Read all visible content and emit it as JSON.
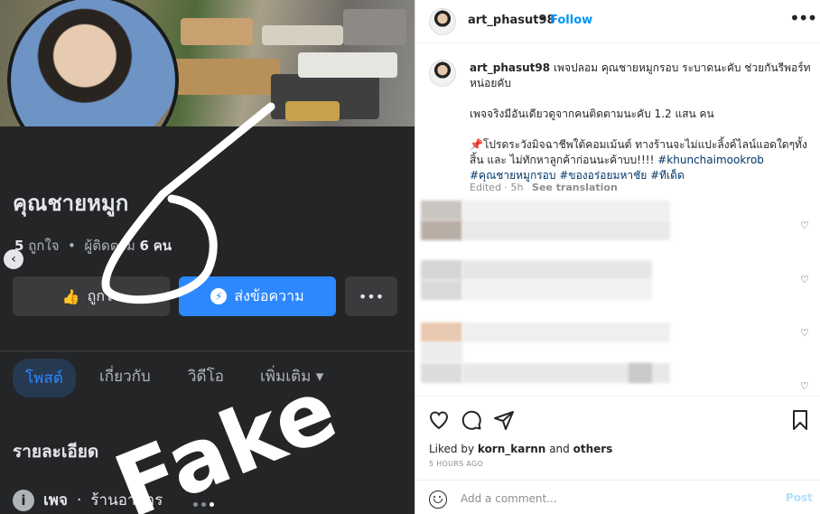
{
  "fb_screenshot": {
    "page_name": "คุณชายหมูก",
    "likes_count": "5",
    "likes_label": "ถูกใจ",
    "followers_label": "ผู้ติดตาม",
    "followers_count": "6",
    "followers_unit": "คน",
    "like_button_label": "ถูกใจ",
    "message_button_label": "ส่งข้อความ",
    "more_button_label": "•••",
    "tabs": [
      "โพสต์",
      "เกี่ยวกับ",
      "วิดีโอ",
      "เพิ่มเติม"
    ],
    "section_title": "รายละเอียด",
    "info_icon": "i",
    "info_type_label": "เพจ",
    "info_category": "ร้านอาหาร",
    "overlay_text": "Fake",
    "colors": {
      "bg": "#242526",
      "accent": "#2d88ff"
    }
  },
  "instagram": {
    "username": "art_phasut98",
    "header_separator": "•",
    "follow_label": "Follow",
    "more_icon": "more-horizontal-icon",
    "caption_username": "art_phasut98",
    "caption_line1": "เพจปลอม คุณชายหมูกรอบ ระบาดนะคับ ช่วยกันรีพอร์ทหน่อยคับ",
    "caption_line2": "เพจจริงมีอันเดียวดูจากคนติดตามนะคับ 1.2 แสน คน",
    "caption_line3": "📌โปรดระวังมิจฉาชีพใต้คอมเม้นต์ ทางร้านจะไม่แปะลิ้งค์ไลน์แอดใดๆทั้งสิ้น และ ไม่ทักหาลูกค้าก่อนนะค้าบบ!!!!",
    "hashtags": [
      "#khunchaimookrob",
      "#คุณชายหมูกรอบ",
      "#ของอร่อยมหาชัย",
      "#ทีเด็ด"
    ],
    "edited_time": "Edited · 5h",
    "see_translation": "See translation",
    "liked_prefix": "Liked by",
    "liked_user": "korn_karnn",
    "liked_suffix": "and",
    "liked_others": "others",
    "posted_ago": "5 HOURS AGO",
    "comment_placeholder": "Add a comment...",
    "post_label": "Post",
    "colors": {
      "link": "#0095f6",
      "hashtag": "#00376b",
      "muted": "#8e8e8e"
    }
  }
}
